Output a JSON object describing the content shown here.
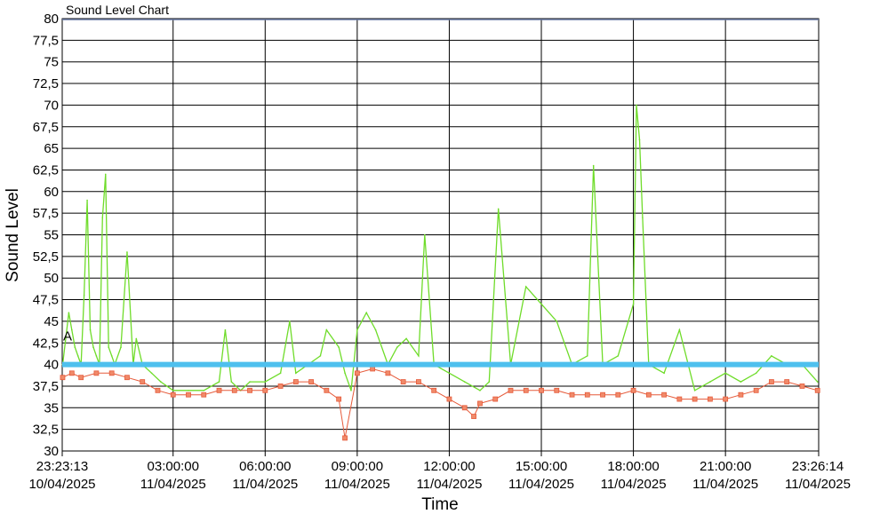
{
  "chart_data": {
    "type": "line",
    "title": "Sound Level Chart",
    "xlabel": "Time",
    "ylabel": "Sound Level",
    "ylim": [
      30,
      80
    ],
    "ytick_step": 2.5,
    "yticks": [
      "30",
      "32,5",
      "35",
      "37,5",
      "40",
      "42,5",
      "45",
      "47,5",
      "50",
      "52,5",
      "55",
      "57,5",
      "60",
      "62,5",
      "65",
      "67,5",
      "70",
      "72,5",
      "75",
      "77,5",
      "80"
    ],
    "x_range_hours": [
      -0.6131,
      24.0372
    ],
    "xticks": [
      {
        "hour": -0.6131,
        "time": "23:23:13",
        "date": "10/04/2025"
      },
      {
        "hour": 3,
        "time": "03:00:00",
        "date": "11/04/2025"
      },
      {
        "hour": 6,
        "time": "06:00:00",
        "date": "11/04/2025"
      },
      {
        "hour": 9,
        "time": "09:00:00",
        "date": "11/04/2025"
      },
      {
        "hour": 12,
        "time": "12:00:00",
        "date": "11/04/2025"
      },
      {
        "hour": 15,
        "time": "15:00:00",
        "date": "11/04/2025"
      },
      {
        "hour": 18,
        "time": "18:00:00",
        "date": "11/04/2025"
      },
      {
        "hour": 21,
        "time": "21:00:00",
        "date": "11/04/2025"
      },
      {
        "hour": 24.0372,
        "time": "23:26:14",
        "date": "11/04/2025"
      }
    ],
    "grid": true,
    "threshold": {
      "value": 40,
      "color": "#4ec0ee"
    },
    "marker_label": "A",
    "colors": {
      "peak_line": "#6fdc2a",
      "level_marker": "#e65a3a",
      "level_marker_fill": "#f08a6a",
      "grid": "#000000"
    },
    "series": [
      {
        "name": "",
        "style": "peak-line",
        "x": [
          -0.6,
          -0.4,
          -0.3,
          -0.2,
          -0.1,
          0.0,
          0.1,
          0.2,
          0.3,
          0.4,
          0.5,
          0.6,
          0.7,
          0.8,
          0.9,
          1.0,
          1.1,
          1.3,
          1.5,
          1.7,
          1.8,
          2.0,
          2.3,
          2.6,
          3.0,
          3.5,
          4.0,
          4.5,
          4.7,
          4.9,
          5.2,
          5.5,
          6.0,
          6.5,
          6.8,
          7.0,
          7.4,
          7.8,
          8.0,
          8.4,
          8.6,
          8.8,
          9.0,
          9.3,
          9.6,
          10.0,
          10.3,
          10.6,
          11.0,
          11.2,
          11.5,
          12.0,
          12.5,
          13.0,
          13.3,
          13.6,
          14.0,
          14.5,
          15.0,
          15.5,
          16.0,
          16.5,
          16.7,
          17.0,
          17.5,
          18.0,
          18.1,
          18.2,
          18.3,
          18.5,
          19.0,
          19.5,
          20.0,
          20.5,
          21.0,
          21.5,
          22.0,
          22.5,
          23.0,
          23.5,
          24.0
        ],
        "values": [
          40,
          46,
          44,
          42,
          41,
          40,
          48,
          59,
          44,
          42,
          41,
          40,
          57,
          62,
          42,
          41,
          40,
          42,
          53,
          40,
          43,
          40,
          39,
          38,
          37,
          37,
          37,
          38,
          44,
          38,
          37,
          38,
          38,
          39,
          45,
          39,
          40,
          41,
          44,
          42,
          39,
          37,
          44,
          46,
          44,
          40,
          42,
          43,
          41,
          55,
          40,
          39,
          38,
          37,
          38,
          58,
          40,
          49,
          47,
          45,
          40,
          41,
          63,
          40,
          41,
          47,
          70,
          66,
          57,
          40,
          39,
          44,
          37,
          38,
          39,
          38,
          39,
          41,
          40,
          40,
          38
        ]
      },
      {
        "name": "",
        "style": "markers",
        "x": [
          -0.6,
          -0.3,
          0.0,
          0.5,
          1.0,
          1.5,
          2.0,
          2.5,
          3.0,
          3.5,
          4.0,
          4.5,
          5.0,
          5.5,
          6.0,
          6.5,
          7.0,
          7.5,
          8.0,
          8.4,
          8.6,
          9.0,
          9.5,
          10.0,
          10.5,
          11.0,
          11.5,
          12.0,
          12.5,
          12.8,
          13.0,
          13.5,
          14.0,
          14.5,
          15.0,
          15.5,
          16.0,
          16.5,
          17.0,
          17.5,
          18.0,
          18.5,
          19.0,
          19.5,
          20.0,
          20.5,
          21.0,
          21.5,
          22.0,
          22.5,
          23.0,
          23.5,
          24.0
        ],
        "values": [
          38.5,
          39,
          38.5,
          39,
          39,
          38.5,
          38,
          37,
          36.5,
          36.5,
          36.5,
          37,
          37,
          37,
          37,
          37.5,
          38,
          38,
          37,
          36,
          31.5,
          39,
          39.5,
          39,
          38,
          38,
          37,
          36,
          35,
          34,
          35.5,
          36,
          37,
          37,
          37,
          37,
          36.5,
          36.5,
          36.5,
          36.5,
          37,
          36.5,
          36.5,
          36,
          36,
          36,
          36,
          36.5,
          37,
          38,
          38,
          37.5,
          37
        ]
      }
    ]
  }
}
